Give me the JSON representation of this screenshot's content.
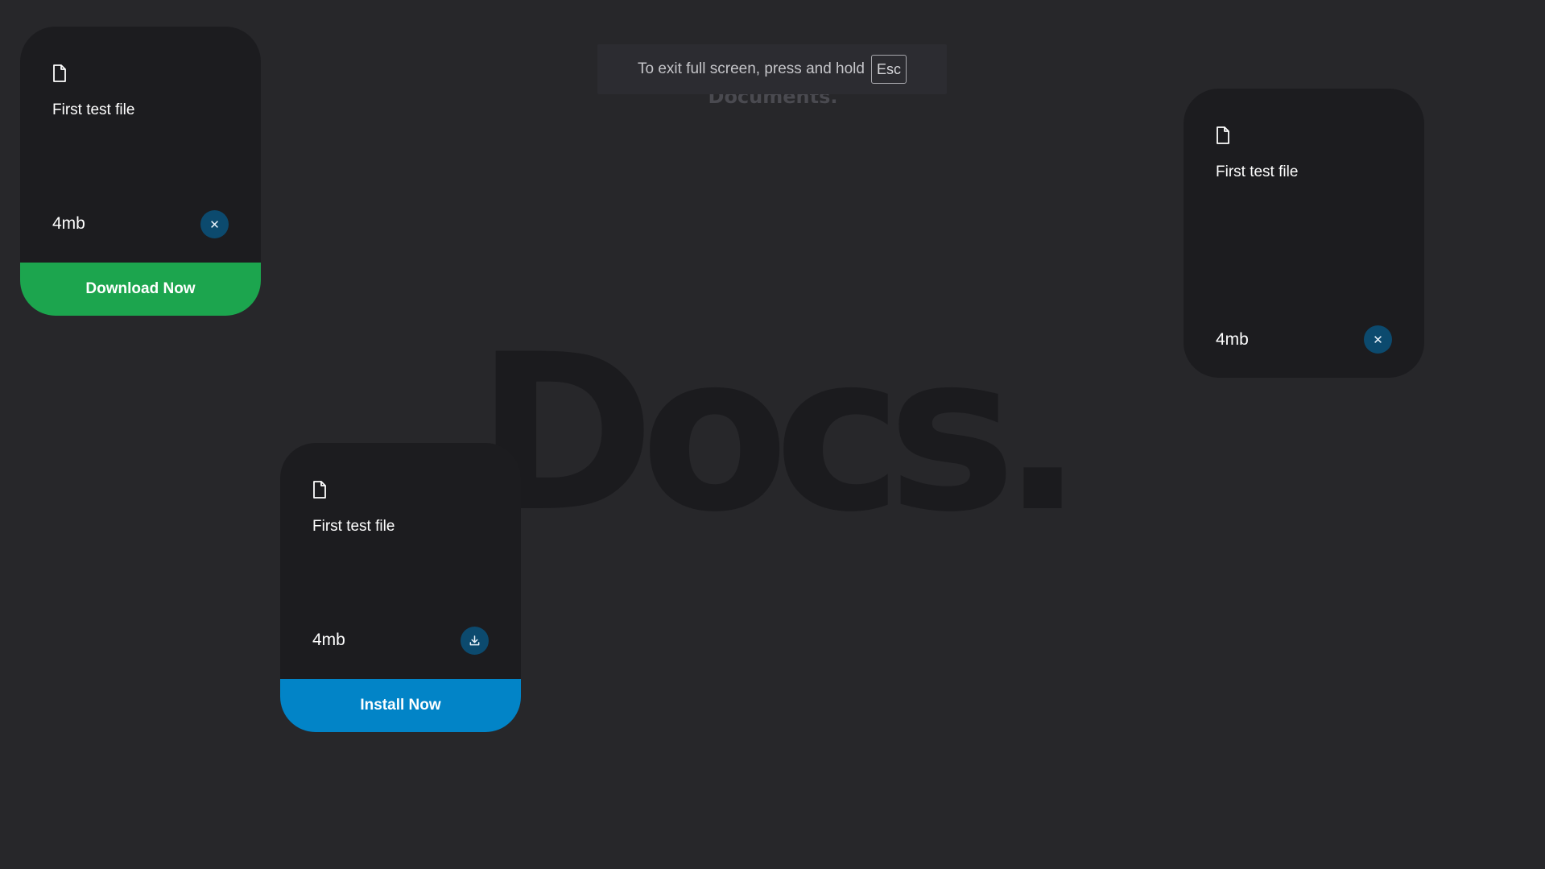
{
  "background": {
    "subtitle": "Documents.",
    "title": "Docs."
  },
  "fullscreen_notice": {
    "text": "To exit full screen, press and hold",
    "key": "Esc"
  },
  "cards": [
    {
      "icon": "document-icon",
      "file_name": "First test file",
      "file_size": "4mb",
      "action_icon": "close-icon",
      "action_glyph": "✕",
      "footer_label": "Download Now",
      "footer_color": "#1ca54e"
    },
    {
      "icon": "document-icon",
      "file_name": "First test file",
      "file_size": "4mb",
      "action_icon": "download-icon",
      "footer_label": "Install Now",
      "footer_color": "#0284c7"
    },
    {
      "icon": "document-icon",
      "file_name": "First test file",
      "file_size": "4mb",
      "action_icon": "close-icon",
      "action_glyph": "✕"
    }
  ],
  "colors": {
    "page_background": "#27272a",
    "card_background": "#1c1c1f",
    "action_button": "#0c4a6e"
  }
}
